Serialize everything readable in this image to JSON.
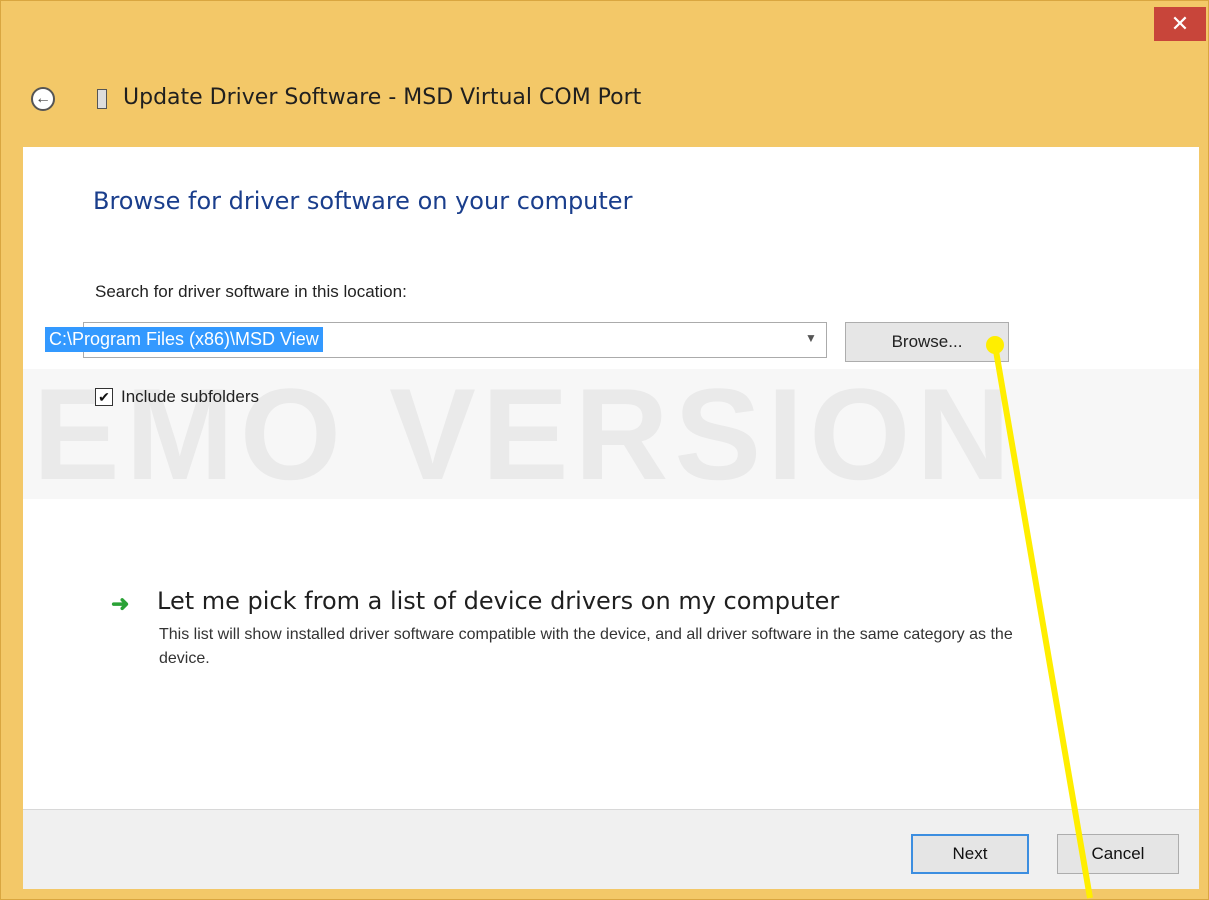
{
  "window": {
    "title": "Update Driver Software - MSD Virtual COM Port",
    "close_label": "✕",
    "back_label": "←"
  },
  "main": {
    "heading": "Browse for driver software on your computer",
    "location_label": "Search for driver software in this location:",
    "path_value": "C:\\Program Files (x86)\\MSD View",
    "browse_label": "Browse...",
    "include_subfolders_label": "Include subfolders",
    "include_subfolders_checked": true,
    "watermark": "DEMO VERSION"
  },
  "pick": {
    "title": "Let me pick from a list of device drivers on my computer",
    "description": "This list will show installed driver software compatible with the device, and all driver software in the same category as the device."
  },
  "footer": {
    "next_label": "Next",
    "cancel_label": "Cancel"
  },
  "colors": {
    "titlebar": "#f3c868",
    "heading": "#1a3e8c",
    "close": "#c8453a",
    "arrow": "#2aa236",
    "annotation": "#ffee00"
  }
}
